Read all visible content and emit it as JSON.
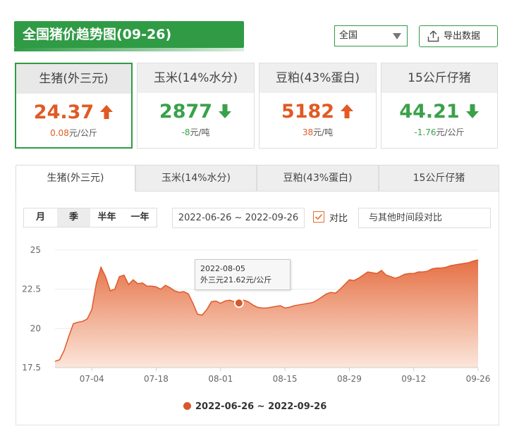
{
  "header": {
    "title": "全国猪价趋势图(09-26)"
  },
  "region": {
    "selected": "全国"
  },
  "export": {
    "label": "导出数据"
  },
  "cards": [
    {
      "name": "生猪(外三元)",
      "value": "24.37",
      "change_num": "0.08",
      "change_unit": "元/公斤",
      "trend": "up"
    },
    {
      "name": "玉米(14%水分)",
      "value": "2877",
      "change_num": "-8",
      "change_unit": "元/吨",
      "trend": "down"
    },
    {
      "name": "豆粕(43%蛋白)",
      "value": "5182",
      "change_num": "38",
      "change_unit": "元/吨",
      "trend": "up"
    },
    {
      "name": "15公斤仔猪",
      "value": "44.21",
      "change_num": "-1.76",
      "change_unit": "元/公斤",
      "trend": "down"
    }
  ],
  "tabs": [
    "生猪(外三元)",
    "玉米(14%水分)",
    "豆粕(43%蛋白)",
    "15公斤仔猪"
  ],
  "periods": [
    "月",
    "季",
    "半年",
    "一年"
  ],
  "active_period": "季",
  "date_range": "2022-06-26 ~ 2022-09-26",
  "compare": {
    "label": "对比",
    "checked": true
  },
  "other_period": "与其他时间段对比",
  "tooltip": {
    "date": "2022-08-05",
    "text": "外三元21.62元/公斤"
  },
  "legend": {
    "label": "2022-06-26 ~ 2022-09-26"
  },
  "colors": {
    "brand_green": "#2f9b45",
    "up": "#e05a24",
    "down": "#3aa14a",
    "series": "#d9572a"
  },
  "chart_data": {
    "type": "area",
    "ylim": [
      17.5,
      25
    ],
    "yticks": [
      17.5,
      20,
      22.5,
      25
    ],
    "xticks": [
      "07-04",
      "07-18",
      "08-01",
      "08-15",
      "08-29",
      "09-12",
      "09-26"
    ],
    "xtick_index": [
      8,
      22,
      36,
      50,
      64,
      78,
      92
    ],
    "highlight_index": 40,
    "series": [
      {
        "x_start": "2022-06-26",
        "values": [
          17.9,
          18.0,
          18.6,
          19.5,
          20.3,
          20.4,
          20.45,
          20.6,
          21.2,
          22.9,
          23.9,
          23.3,
          22.4,
          22.5,
          23.3,
          23.4,
          22.8,
          23.1,
          22.85,
          22.9,
          22.7,
          22.7,
          22.65,
          22.5,
          22.75,
          22.6,
          22.4,
          22.3,
          22.35,
          22.2,
          21.6,
          20.9,
          20.85,
          21.2,
          21.7,
          21.75,
          21.6,
          21.75,
          21.8,
          21.7,
          21.62,
          21.8,
          21.7,
          21.5,
          21.35,
          21.3,
          21.3,
          21.35,
          21.4,
          21.45,
          21.3,
          21.35,
          21.45,
          21.5,
          21.55,
          21.6,
          21.65,
          21.8,
          22.0,
          22.2,
          22.3,
          22.25,
          22.5,
          22.8,
          23.1,
          23.05,
          23.2,
          23.4,
          23.6,
          23.55,
          23.5,
          23.7,
          23.4,
          23.3,
          23.2,
          23.3,
          23.45,
          23.5,
          23.5,
          23.6,
          23.6,
          23.65,
          23.8,
          23.85,
          23.85,
          23.9,
          24.0,
          24.05,
          24.1,
          24.15,
          24.2,
          24.3,
          24.37
        ]
      }
    ]
  }
}
